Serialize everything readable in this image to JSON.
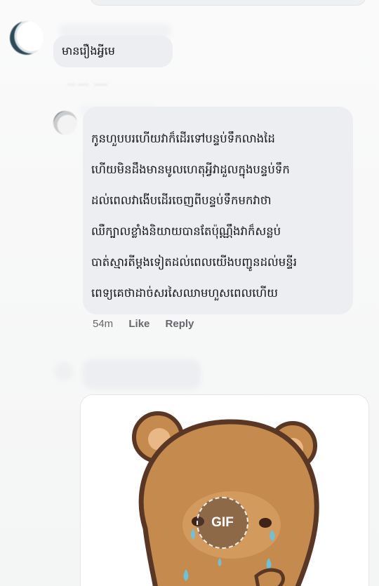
{
  "comments": [
    {
      "text": "មានរឿងអ្វីមេ"
    },
    {
      "lines": [
        "កូនហួបបរហើយវាក៏ដើរទៅបន្ទប់ទឹកលាងដៃ",
        "ហើយមិនដឹងមានមូលហេតុអ្វីវាដួលក្នុងបន្ទប់ទឹក",
        "ដល់ពេលវាងើបដើរចេញពីបន្ទប់ទឹកមកវាថា",
        "ឈឺក្បាលខ្លាំងនិយាយបានតែប៉ុណ្ណឹងវាក៏សន្លប់",
        "បាត់ស្មារតីម្ដងទៀតដល់ពេលយើងបញ្ជូនដល់មន្ទីរ",
        "ពេទ្យគេថាដាច់សរសៃឈាមហួសពេលហើយ"
      ],
      "time": "54m",
      "like_label": "Like",
      "reply_label": "Reply"
    }
  ],
  "gif": {
    "badge_label": "GIF",
    "icon": "crying-bear-sticker"
  },
  "colors": {
    "bubble": "#eceef1",
    "meta_text": "#65676b",
    "bear_fur": "#c58a4e",
    "bear_outline": "#5a3624",
    "tear": "#6ec1d6"
  }
}
